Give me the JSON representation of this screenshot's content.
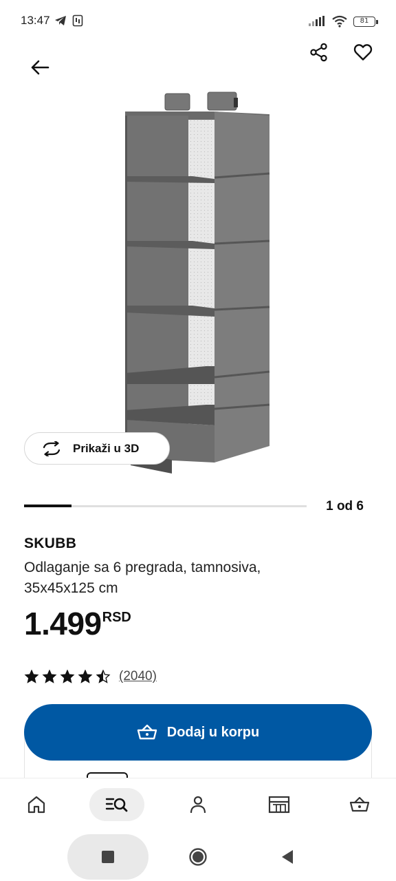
{
  "status_bar": {
    "time": "13:47",
    "battery": "81",
    "icons": [
      "telegram-icon",
      "sim-icon",
      "signal-icon",
      "wifi-icon",
      "battery-icon"
    ]
  },
  "header": {
    "back_icon": "arrow-left-icon",
    "share_icon": "share-icon",
    "favorite_icon": "heart-icon"
  },
  "gallery": {
    "view_3d_label": "Prikaži u 3D",
    "counter": "1 od 6",
    "current": 1,
    "total": 6
  },
  "product": {
    "name": "SKUBB",
    "description": "Odlaganje sa 6 pregrada, tamnosiva, 35x45x125 cm",
    "price": "1.499",
    "currency": "RSD",
    "rating": 4.5,
    "reviews": "(2040)"
  },
  "cart": {
    "add_label": "Dodaj u korpu",
    "icon": "basket-icon"
  },
  "bottom_nav": {
    "items": [
      "home-icon",
      "search-browse-icon",
      "profile-icon",
      "store-icon",
      "basket-icon"
    ],
    "active": "search-browse-icon"
  },
  "colors": {
    "primary": "#0058a3",
    "text": "#111111",
    "muted": "#484848",
    "product_gray": "#707070"
  }
}
